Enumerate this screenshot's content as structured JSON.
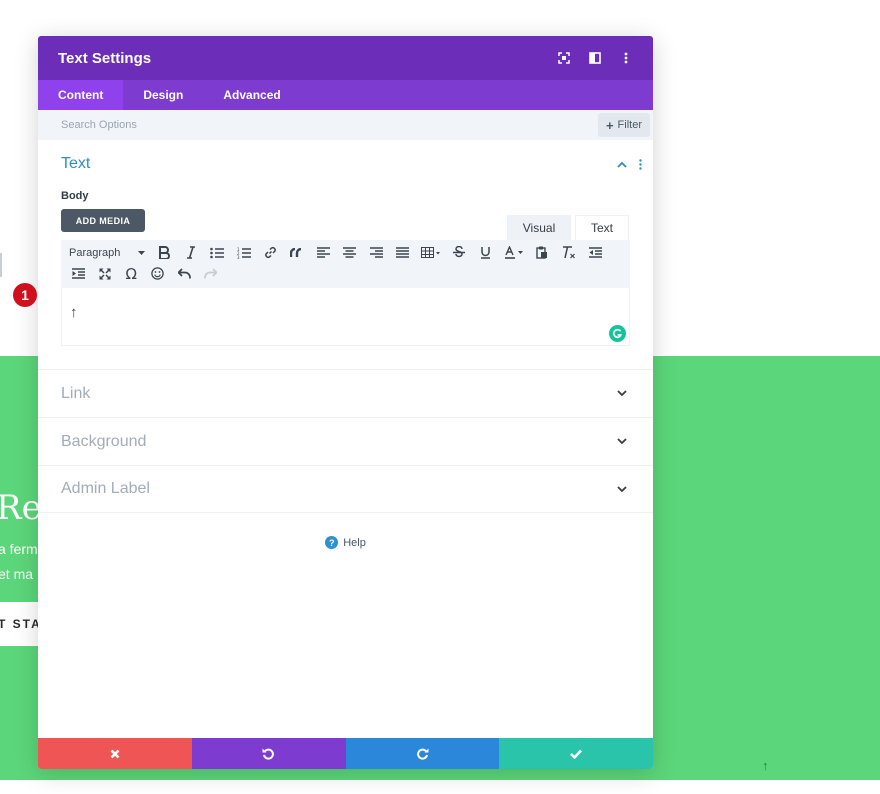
{
  "background_page": {
    "heading_fragment": "Re",
    "text_line_1": "a ferm",
    "text_line_2": "et ma",
    "button_fragment": "T STA",
    "arrow_glyph": "↑",
    "accent_color": "#5cd67a"
  },
  "modal": {
    "title": "Text Settings",
    "header_icons": [
      "expand-icon",
      "split-view-icon",
      "kebab-icon"
    ],
    "tabs": [
      {
        "label": "Content",
        "active": true
      },
      {
        "label": "Design",
        "active": false
      },
      {
        "label": "Advanced",
        "active": false
      }
    ],
    "search": {
      "placeholder": "Search Options",
      "filter_label": "Filter"
    },
    "text_section": {
      "title": "Text",
      "body_label": "Body",
      "add_media_label": "ADD MEDIA",
      "mode_tabs": {
        "visual": "Visual",
        "text": "Text",
        "active": "Text"
      },
      "toolbar": {
        "format_select": "Paragraph",
        "row1_icons": [
          "bold-icon",
          "italic-icon",
          "bullet-list-icon",
          "numbered-list-icon",
          "link-icon",
          "blockquote-icon",
          "align-left-icon",
          "align-center-icon",
          "align-right-icon",
          "align-justify-icon",
          "table-icon",
          "strikethrough-icon",
          "underline-icon",
          "text-color-icon",
          "paste-icon",
          "clear-format-icon",
          "outdent-icon"
        ],
        "row2_icons": [
          "indent-icon",
          "fullscreen-icon",
          "omega-icon",
          "emoji-icon",
          "undo-icon",
          "redo-icon"
        ]
      },
      "editor_content": "↑",
      "step_badge": "1"
    },
    "collapsed_sections": [
      {
        "title": "Link"
      },
      {
        "title": "Background"
      },
      {
        "title": "Admin Label"
      }
    ],
    "help_label": "Help",
    "footer_buttons": [
      "cancel-icon",
      "undo-icon",
      "redo-icon",
      "save-icon"
    ],
    "colors": {
      "header": "#6c2eb9",
      "tabs": "#7e3bd0",
      "active_tab": "#8f42ec",
      "section_title": "#2e8fbd",
      "cancel": "#ef5555",
      "undo": "#7e3bd0",
      "redo": "#2b87da",
      "save": "#29c4a9"
    }
  }
}
